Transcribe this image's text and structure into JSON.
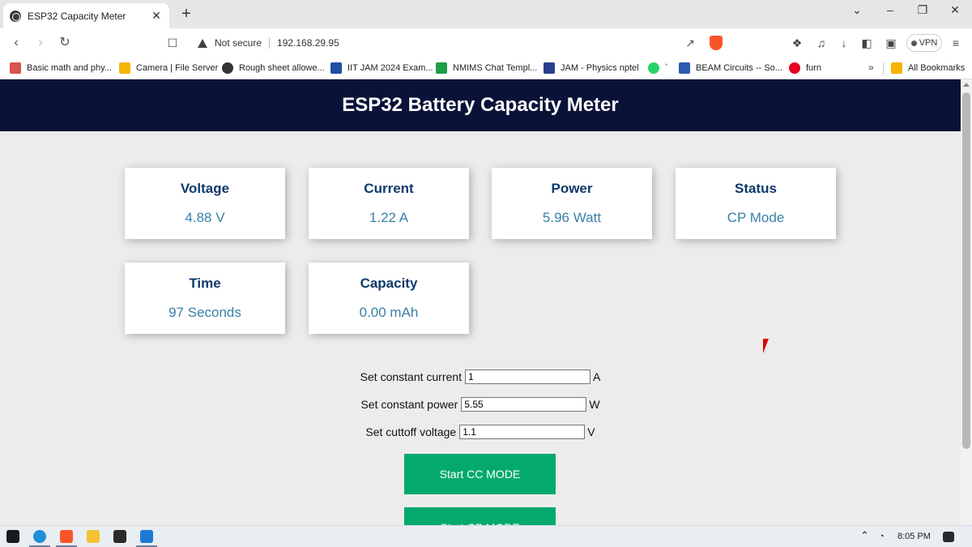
{
  "browser": {
    "tab_title": "ESP32 Capacity Meter",
    "tab_close": "✕",
    "new_tab": "+",
    "window_controls": [
      "⌄",
      "–",
      "❐",
      "✕"
    ],
    "security_text": "Not secure",
    "url": "192.168.29.95",
    "vpn_label": "VPN",
    "bookmarks": [
      {
        "label": "Basic math and phy...",
        "color": "#d9534f"
      },
      {
        "label": "Camera | File Server",
        "color": "#f5b400"
      },
      {
        "label": "Rough sheet allowe...",
        "color": "#333333"
      },
      {
        "label": "IIT JAM 2024 Exam...",
        "color": "#1e4fa3"
      },
      {
        "label": "NMIMS Chat Templ...",
        "color": "#1e9e47"
      },
      {
        "label": "JAM - Physics nptel",
        "color": "#2b3f8f"
      },
      {
        "label": "`",
        "color": "#25d366"
      },
      {
        "label": "BEAM Circuits -- So...",
        "color": "#2a5db0"
      },
      {
        "label": "furn",
        "color": "#e60023"
      }
    ],
    "bookmarks_more": "»",
    "all_bookmarks": "All Bookmarks"
  },
  "page": {
    "header": "ESP32 Battery Capacity Meter",
    "cards": [
      {
        "label": "Voltage",
        "value": "4.88 V"
      },
      {
        "label": "Current",
        "value": "1.22 A"
      },
      {
        "label": "Power",
        "value": "5.96 Watt"
      },
      {
        "label": "Status",
        "value": "CP Mode"
      },
      {
        "label": "Time",
        "value": "97 Seconds"
      },
      {
        "label": "Capacity",
        "value": "0.00 mAh"
      }
    ],
    "form": [
      {
        "label": "Set constant current",
        "value": "1",
        "unit": "A"
      },
      {
        "label": "Set constant power",
        "value": "5.55",
        "unit": "W"
      },
      {
        "label": "Set cuttoff voltage",
        "value": "1.1",
        "unit": "V"
      }
    ],
    "buttons": {
      "start_cc": "Start CC MODE",
      "start_cp": "Start CP MODE"
    },
    "colors": {
      "header_bg": "#0b1238",
      "button_bg": "#04aa6d",
      "label_color": "#0f3a6b",
      "value_color": "#3a7fa8"
    }
  },
  "taskbar": {
    "time": "8:05 PM"
  }
}
